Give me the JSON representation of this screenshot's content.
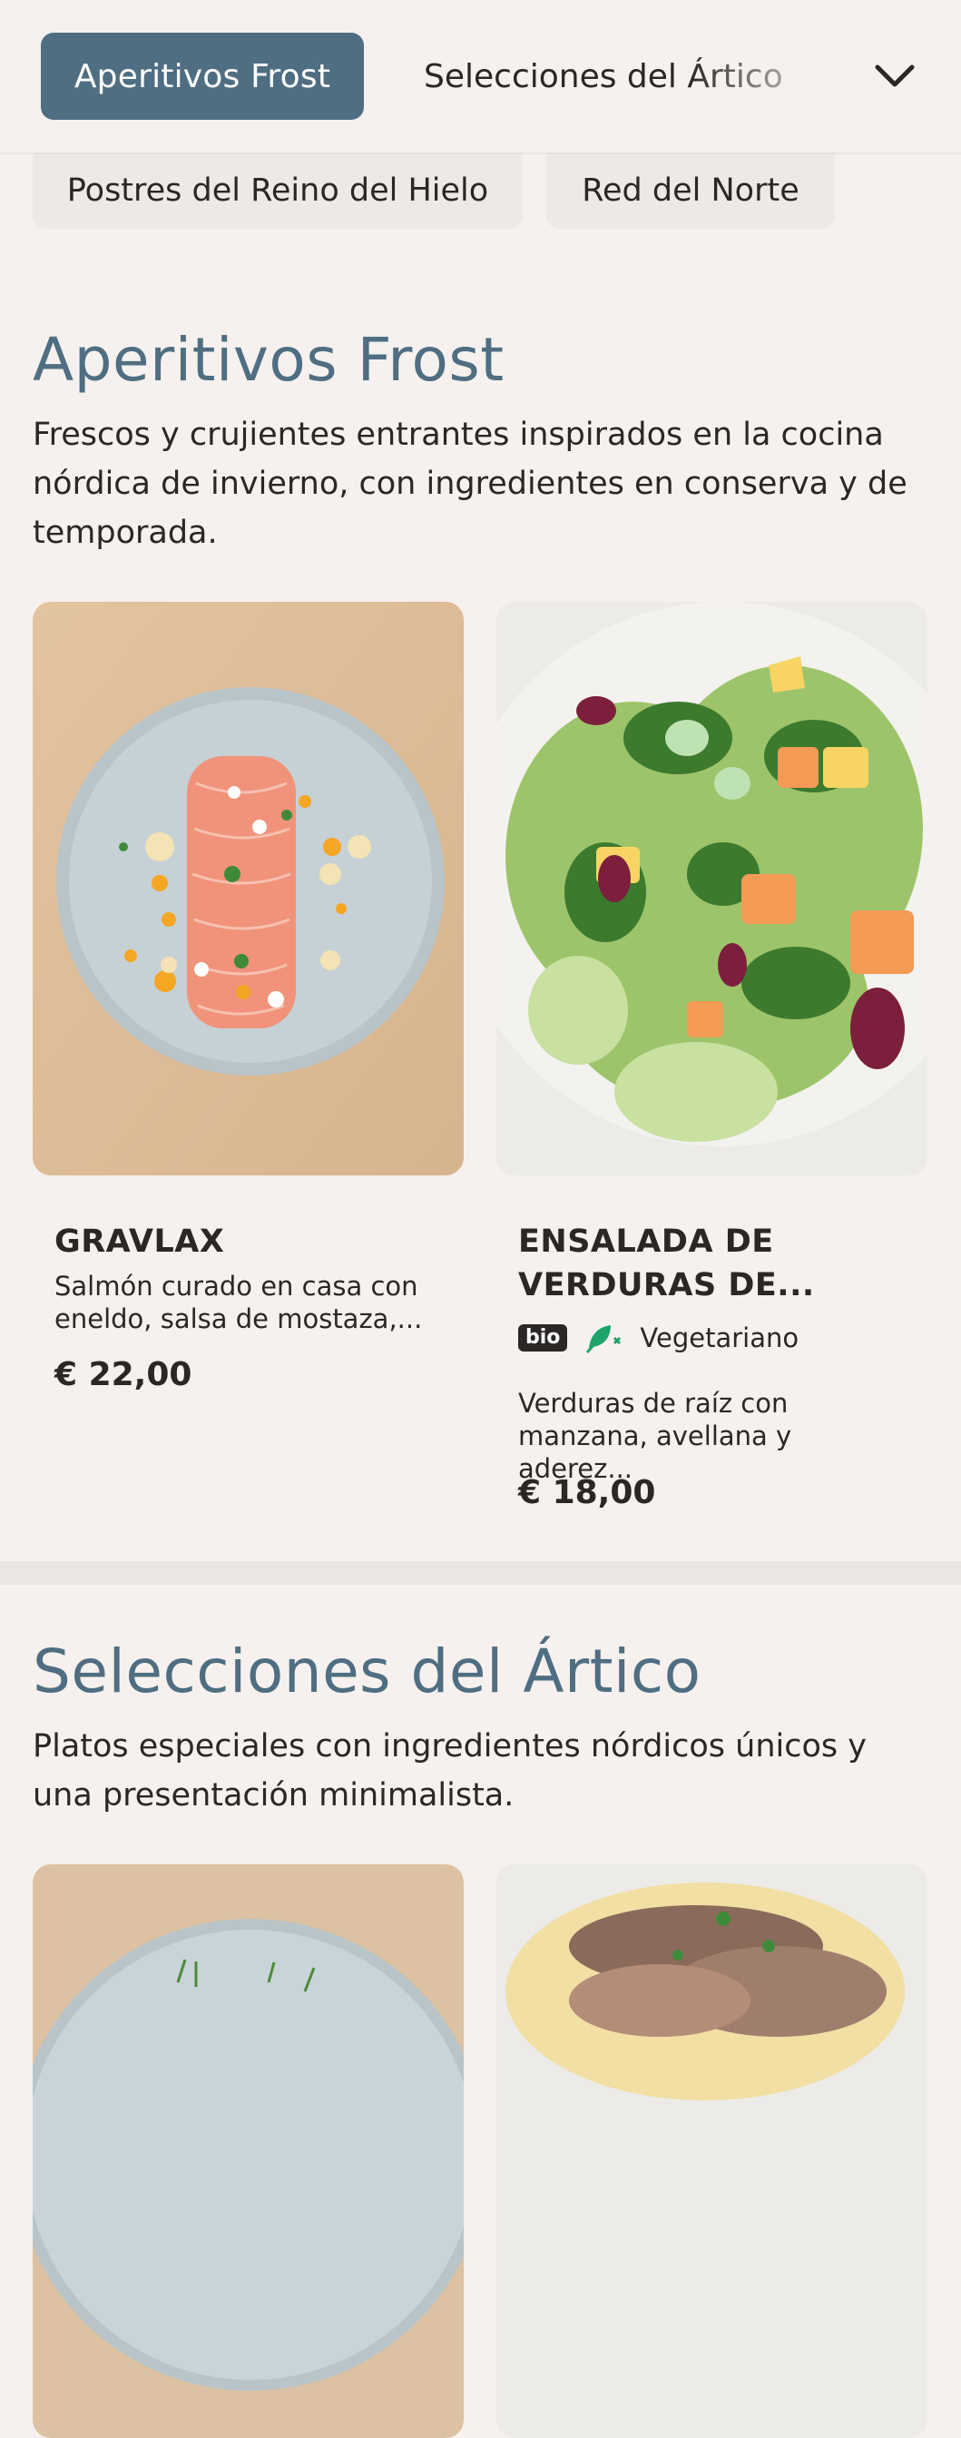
{
  "nav": {
    "active_tab": "Aperitivos Frost",
    "next_tab": "Selecciones del Ártico",
    "chips": [
      "Postres del Reino del Hielo",
      "Red del Norte"
    ]
  },
  "sections": [
    {
      "title": "Aperitivos Frost",
      "description": "Frescos y crujientes entrantes inspirados en la cocina nórdica de invierno, con ingredientes en conserva y de temporada.",
      "items": [
        {
          "name": "GRAVLAX",
          "description": "Salmón curado en casa con eneldo, salsa de mostaza,...",
          "price": "€ 22,00"
        },
        {
          "name": "ENSALADA DE VERDURAS DE...",
          "badge": "bio",
          "diet": "Vegetariano",
          "description": "Verduras de raíz con manzana, avellana y aderez...",
          "price": "€ 18,00"
        }
      ]
    },
    {
      "title": "Selecciones del Ártico",
      "description": "Platos especiales con ingredientes nórdicos únicos y una presentación minimalista."
    }
  ],
  "icons": {
    "dropdown": "chevron-down-icon",
    "vegetarian": "veggie-leaf-icon"
  },
  "colors": {
    "accent": "#4f6e82",
    "background": "#f6f1ee",
    "veggie": "#1ea36a"
  }
}
